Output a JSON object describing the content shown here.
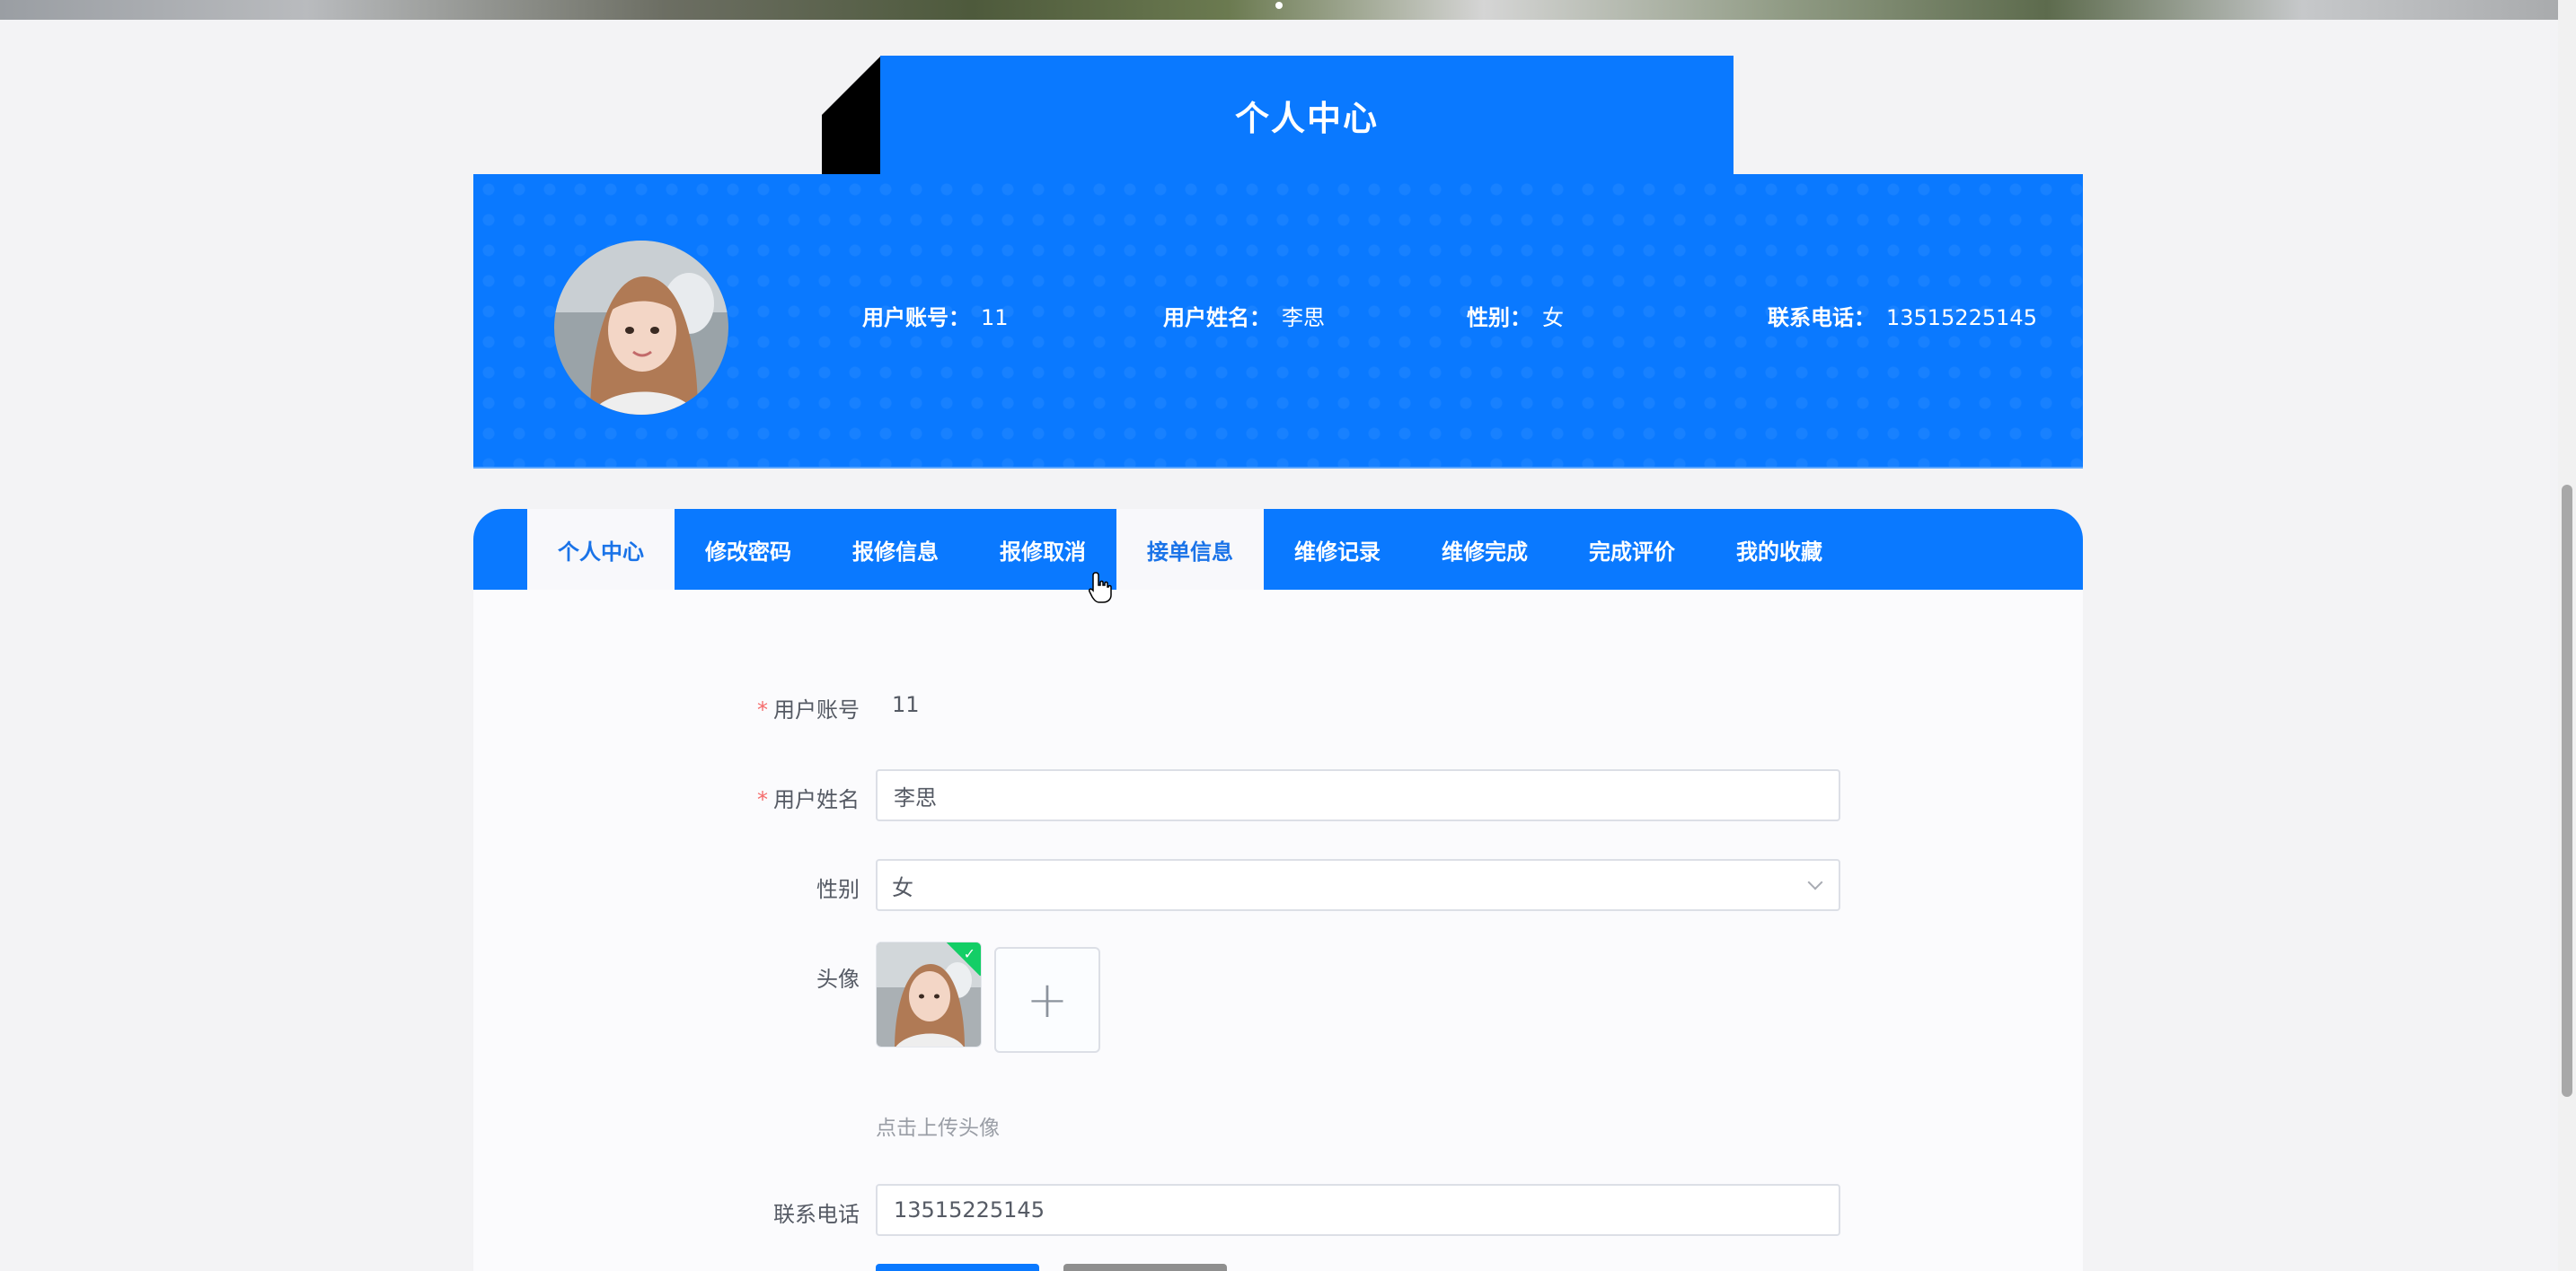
{
  "header": {
    "title": "个人中心"
  },
  "profile": {
    "account_label": "用户账号：",
    "account_value": "11",
    "name_label": "用户姓名：",
    "name_value": "李思",
    "gender_label": "性别：",
    "gender_value": "女",
    "phone_label": "联系电话：",
    "phone_value": "13515225145"
  },
  "tabs": [
    {
      "label": "个人中心",
      "active": true
    },
    {
      "label": "修改密码",
      "active": false
    },
    {
      "label": "报修信息",
      "active": false
    },
    {
      "label": "报修取消",
      "active": false
    },
    {
      "label": "接单信息",
      "active": true
    },
    {
      "label": "维修记录",
      "active": false
    },
    {
      "label": "维修完成",
      "active": false
    },
    {
      "label": "完成评价",
      "active": false
    },
    {
      "label": "我的收藏",
      "active": false
    }
  ],
  "form": {
    "account_label": "用户账号",
    "account_value": "11",
    "name_label": "用户姓名",
    "name_value": "李思",
    "gender_label": "性别",
    "gender_value": "女",
    "avatar_label": "头像",
    "avatar_hint": "点击上传头像",
    "phone_label": "联系电话",
    "phone_value": "13515225145",
    "required_mark": "*"
  },
  "icons": {
    "upload": "plus-icon",
    "select": "chevron-down-icon",
    "uploaded": "check-icon"
  },
  "colors": {
    "primary": "#0a79ff",
    "required": "#f56c6c",
    "success": "#13ce66"
  }
}
